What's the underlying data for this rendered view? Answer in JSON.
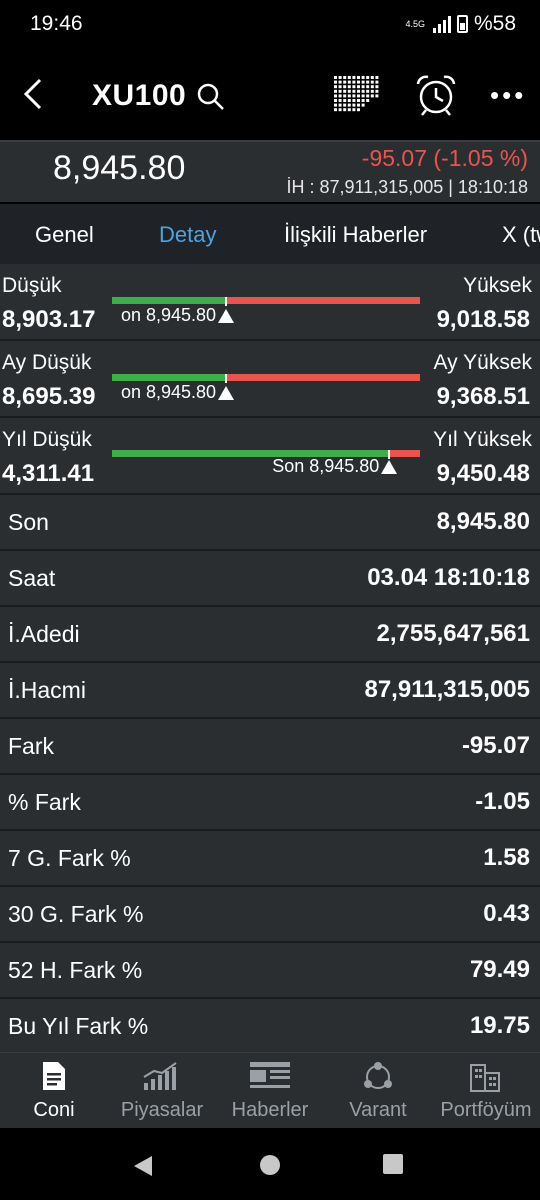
{
  "status": {
    "time": "19:46",
    "network": "4.5G",
    "battery": "%58"
  },
  "header": {
    "title": "XU100"
  },
  "quote": {
    "price": "8,945.80",
    "change": "-95.07 (-1.05 %)",
    "ih_line": "İH : 87,911,315,005  |  18:10:18"
  },
  "tabs": [
    {
      "label": "Genel"
    },
    {
      "label": "Detay"
    },
    {
      "label": "İlişkili Haberler"
    },
    {
      "label": "X (tw"
    }
  ],
  "ranges": [
    {
      "low_label": "Düşük",
      "low": "8,903.17",
      "high_label": "Yüksek",
      "high": "9,018.58",
      "current": "on 8,945.80",
      "position": 0.37
    },
    {
      "low_label": "Ay Düşük",
      "low": "8,695.39",
      "high_label": "Ay Yüksek",
      "high": "9,368.51",
      "current": "on 8,945.80",
      "position": 0.37
    },
    {
      "low_label": "Yıl Düşük",
      "low": "4,311.41",
      "high_label": "Yıl Yüksek",
      "high": "9,450.48",
      "current": "Son 8,945.80",
      "position": 0.9
    }
  ],
  "rows": [
    {
      "label": "Son",
      "value": "8,945.80"
    },
    {
      "label": "Saat",
      "value": "03.04 18:10:18"
    },
    {
      "label": "İ.Adedi",
      "value": "2,755,647,561"
    },
    {
      "label": "İ.Hacmi",
      "value": "87,911,315,005"
    },
    {
      "label": "Fark",
      "value": "-95.07"
    },
    {
      "label": "% Fark",
      "value": "-1.05"
    },
    {
      "label": "7 G. Fark %",
      "value": "1.58"
    },
    {
      "label": "30 G. Fark %",
      "value": "0.43"
    },
    {
      "label": "52 H. Fark %",
      "value": "79.49"
    },
    {
      "label": "Bu Yıl Fark %",
      "value": "19.75"
    }
  ],
  "bottom_nav": [
    {
      "label": "Coni",
      "icon": "document-icon"
    },
    {
      "label": "Piyasalar",
      "icon": "chart-bars-icon"
    },
    {
      "label": "Haberler",
      "icon": "news-icon"
    },
    {
      "label": "Varant",
      "icon": "cycle-icon"
    },
    {
      "label": "Portföyüm",
      "icon": "buildings-icon"
    }
  ],
  "colors": {
    "up": "#3fae49",
    "down": "#e8554e",
    "accent": "#4fa3e0"
  }
}
